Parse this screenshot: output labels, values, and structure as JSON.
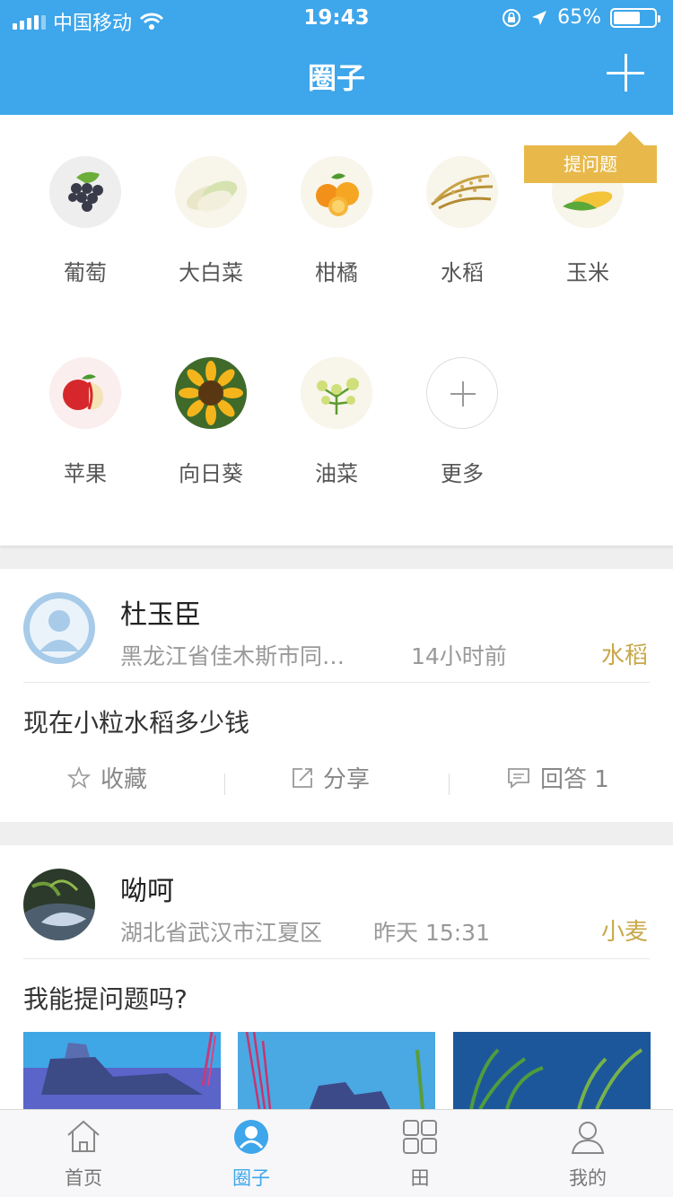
{
  "status_bar": {
    "carrier": "中国移动",
    "time": "19:43",
    "battery": "65%",
    "battery_level": 0.65
  },
  "nav": {
    "title": "圈子"
  },
  "tooltip": {
    "text": "提问题"
  },
  "categories": [
    {
      "label": "葡萄",
      "icon": "grape-icon"
    },
    {
      "label": "大白菜",
      "icon": "cabbage-icon"
    },
    {
      "label": "柑橘",
      "icon": "orange-icon"
    },
    {
      "label": "水稻",
      "icon": "rice-icon"
    },
    {
      "label": "玉米",
      "icon": "corn-icon"
    },
    {
      "label": "苹果",
      "icon": "apple-icon"
    },
    {
      "label": "向日葵",
      "icon": "sunflower-icon"
    },
    {
      "label": "油菜",
      "icon": "rapeseed-icon"
    },
    {
      "label": "更多",
      "icon": "plus-icon"
    }
  ],
  "posts": [
    {
      "user": "杜玉臣",
      "location": "黑龙江省佳木斯市同…",
      "time": "14小时前",
      "tag": "水稻",
      "content": "现在小粒水稻多少钱",
      "actions": {
        "favorite": "收藏",
        "share": "分享",
        "answer": "回答 1"
      }
    },
    {
      "user": "呦呵",
      "location": "湖北省武汉市江夏区",
      "time": "昨天 15:31",
      "tag": "小麦",
      "content": "我能提问题吗?"
    }
  ],
  "tabbar": [
    {
      "label": "首页",
      "icon": "home-icon"
    },
    {
      "label": "圈子",
      "icon": "circle-icon",
      "active": true
    },
    {
      "label": "田",
      "icon": "grid-icon"
    },
    {
      "label": "我的",
      "icon": "user-icon"
    }
  ],
  "colors": {
    "primary": "#3ea6ea",
    "tag": "#c8a849",
    "tooltip": "#e8b94a"
  }
}
